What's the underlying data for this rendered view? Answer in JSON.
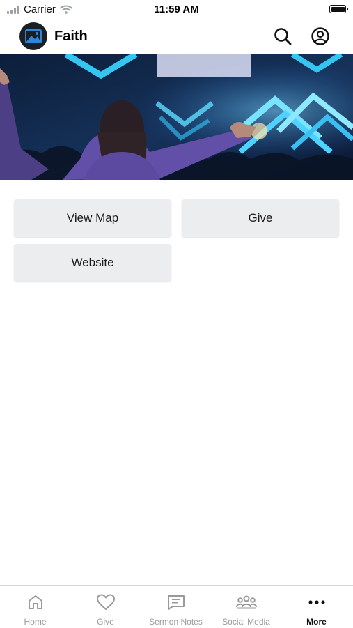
{
  "status_bar": {
    "carrier": "Carrier",
    "time": "11:59 AM"
  },
  "header": {
    "title": "Faith",
    "icons": [
      "logo-icon",
      "search-icon",
      "profile-icon"
    ]
  },
  "buttons": {
    "view_map": "View Map",
    "give": "Give",
    "website": "Website"
  },
  "tabs": [
    {
      "label": "Home",
      "icon": "home-icon"
    },
    {
      "label": "Give",
      "icon": "heart-icon"
    },
    {
      "label": "Sermon Notes",
      "icon": "notes-icon"
    },
    {
      "label": "Social Media",
      "icon": "people-icon"
    },
    {
      "label": "More",
      "icon": "more-icon",
      "active": true
    }
  ],
  "colors": {
    "button_bg": "#ebedef",
    "inactive_tab": "#9a9a9a",
    "active_tab": "#111111"
  }
}
